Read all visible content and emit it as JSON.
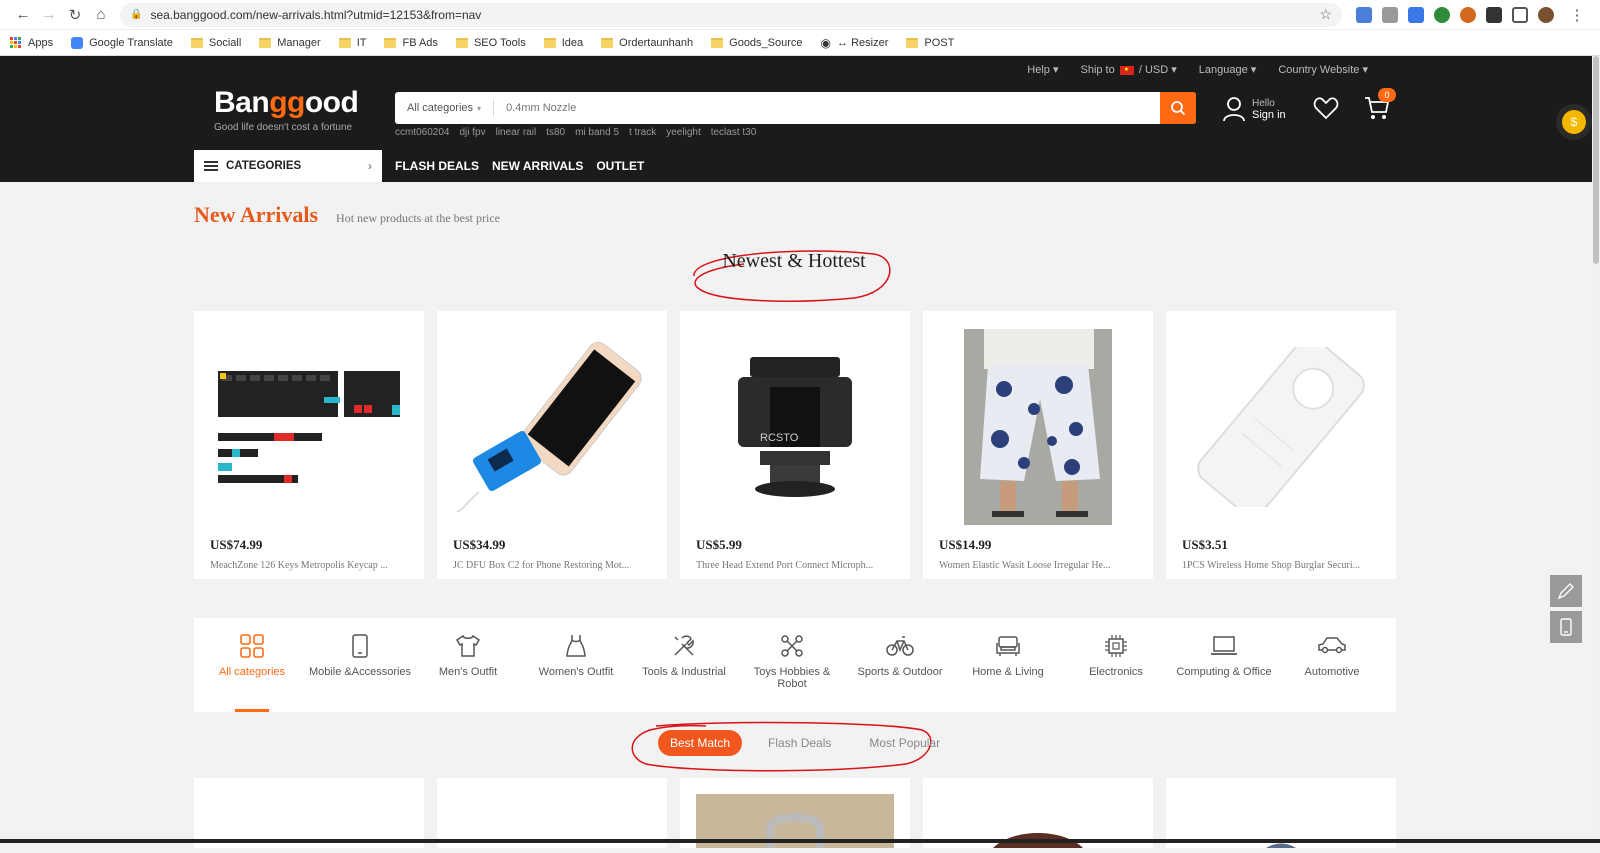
{
  "browser": {
    "url": "sea.banggood.com/new-arrivals.html?utmid=12153&from=nav",
    "bookmarks": [
      "Apps",
      "Google Translate",
      "Sociall",
      "Manager",
      "IT",
      "FB Ads",
      "SEO Tools",
      "Idea",
      "Ordertaunhanh",
      "Goods_Source",
      "↔ Resizer",
      "POST"
    ]
  },
  "header": {
    "top_links": {
      "help": "Help ▾",
      "ship_to": "Ship to",
      "currency": "/ USD ▾",
      "language": "Language ▾",
      "country": "Country Website ▾"
    },
    "logo_a": "Ban",
    "logo_b": "gg",
    "logo_c": "ood",
    "tagline": "Good life doesn't cost a fortune",
    "search_category": "All categories",
    "search_placeholder": "0.4mm Nozzle",
    "hot_words": [
      "ccmt060204",
      "dji fpv",
      "linear rail",
      "ts80",
      "mi band 5",
      "t track",
      "yeelight",
      "teclast t30"
    ],
    "hello": "Hello",
    "sign_in": "Sign in",
    "cart_count": "0",
    "categories_label": "CATEGORIES",
    "nav_links": [
      "FLASH DEALS",
      "NEW ARRIVALS",
      "OUTLET"
    ]
  },
  "main": {
    "title": "New Arrivals",
    "subtitle": "Hot new products at the best price",
    "section_title": "Newest & Hottest",
    "products": [
      {
        "price": "US$74.99",
        "name": "MeachZone 126 Keys Metropolis Keycap ..."
      },
      {
        "price": "US$34.99",
        "name": "JC DFU Box C2 for Phone Restoring Mot..."
      },
      {
        "price": "US$5.99",
        "name": "Three Head Extend Port Connect Microph..."
      },
      {
        "price": "US$14.99",
        "name": "Women Elastic Wasit Loose Irregular He..."
      },
      {
        "price": "US$3.51",
        "name": "1PCS Wireless Home Shop Burglar Securi..."
      }
    ],
    "categories": [
      {
        "label": "All categories",
        "icon": "grid-icon"
      },
      {
        "label": "Mobile &Accessories",
        "icon": "phone-icon"
      },
      {
        "label": "Men's Outfit",
        "icon": "tshirt-icon"
      },
      {
        "label": "Women's Outfit",
        "icon": "dress-icon"
      },
      {
        "label": "Tools & Industrial",
        "icon": "tools-icon"
      },
      {
        "label": "Toys Hobbies & Robot",
        "icon": "drone-icon"
      },
      {
        "label": "Sports & Outdoor",
        "icon": "bike-icon"
      },
      {
        "label": "Home & Living",
        "icon": "sofa-icon"
      },
      {
        "label": "Electronics",
        "icon": "chip-icon"
      },
      {
        "label": "Computing & Office",
        "icon": "laptop-icon"
      },
      {
        "label": "Automotive",
        "icon": "car-icon"
      }
    ],
    "tabs": [
      "Best Match",
      "Flash Deals",
      "Most Popular"
    ]
  },
  "colors": {
    "accent": "#ff6a13",
    "header_bg": "#1b1b1b",
    "annotation": "#d9131a"
  }
}
